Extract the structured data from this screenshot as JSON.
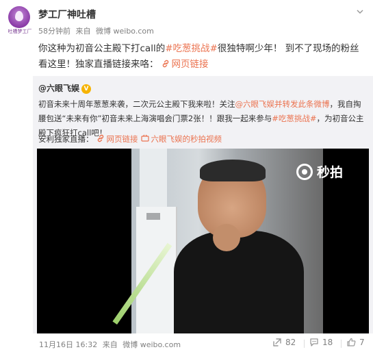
{
  "avatar": {
    "caption": "吐槽梦工厂"
  },
  "post": {
    "author": "梦工厂神吐槽",
    "time": "58分钟前",
    "from_label": "来自",
    "source": "微博 weibo.com",
    "text_before_topic": "你这种为初音公主殿下打call的",
    "topic": "#吃葱挑战#",
    "text_after_topic": "很独特啊少年！ 到不了现场的粉丝看这里！独家直播链接来咯：",
    "link_label": "网页链接"
  },
  "repost": {
    "author": "@六眼飞娱",
    "verified_badge": "V",
    "text_part1": "初音未来十周年葱葱来袭，二次元公主殿下我来啦！关注",
    "mention": "@六眼飞娱并转发此条微博",
    "text_part2": "，我自掏腰包送“未来有你”初音未来上海演唱会门票2张！！跟我一起来参与",
    "topic": "#吃葱挑战#",
    "text_part3": "，为初音公主殿下疯狂打call吧！",
    "live_prefix": "安利独家直播：",
    "live_link": "网页链接",
    "video_link": "六眼飞娱的秒拍视频",
    "video_watermark": "秒拍"
  },
  "footer": {
    "date": "11月16日 16:32",
    "from_label": "来自",
    "source": "微博 weibo.com",
    "repost_count": "82",
    "comment_count": "18",
    "like_count": "7"
  },
  "colors": {
    "accent": "#eb7350",
    "repost_bg": "#f2f2f5",
    "meta": "#808080"
  }
}
